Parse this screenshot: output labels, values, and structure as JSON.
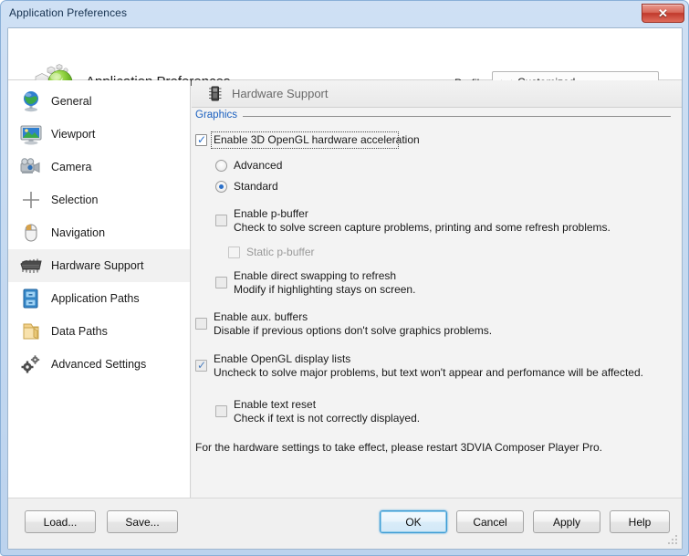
{
  "window": {
    "title": "Application Preferences",
    "close_label": "✕"
  },
  "header": {
    "app_title": "Application Preferences",
    "logo_icon": "3dvia-sphere-cubes-icon",
    "profile_label": "Profile",
    "profile_value": "Customized",
    "profile_icon": "profile-connector-icon"
  },
  "sidebar": {
    "items": [
      {
        "label": "General",
        "icon": "globe-icon",
        "selected": false
      },
      {
        "label": "Viewport",
        "icon": "monitor-icon",
        "selected": false
      },
      {
        "label": "Camera",
        "icon": "camera-icon",
        "selected": false
      },
      {
        "label": "Selection",
        "icon": "plus-cross-icon",
        "selected": false
      },
      {
        "label": "Navigation",
        "icon": "mouse-icon",
        "selected": false
      },
      {
        "label": "Hardware Support",
        "icon": "chip-icon",
        "selected": true
      },
      {
        "label": "Application Paths",
        "icon": "cabinet-icon",
        "selected": false
      },
      {
        "label": "Data Paths",
        "icon": "folder-icon",
        "selected": false
      },
      {
        "label": "Advanced Settings",
        "icon": "gears-icon",
        "selected": false
      }
    ]
  },
  "panel": {
    "header_title": "Hardware Support",
    "header_icon": "chip-icon",
    "group_label": "Graphics",
    "options": {
      "opengl_accel": {
        "label": "Enable 3D OpenGL hardware acceleration",
        "checked": true,
        "focused": true
      },
      "mode_advanced": {
        "label": "Advanced",
        "selected": false
      },
      "mode_standard": {
        "label": "Standard",
        "selected": true
      },
      "pbuffer": {
        "label": "Enable p-buffer",
        "description": "Check to solve screen capture problems, printing and some refresh problems.",
        "checked": false
      },
      "static_pbuffer": {
        "label": "Static p-buffer",
        "checked": false,
        "disabled": true
      },
      "direct_swapping": {
        "label": "Enable direct swapping to refresh",
        "description": "Modify if highlighting stays on screen.",
        "checked": false
      },
      "aux_buffers": {
        "label": "Enable aux. buffers",
        "description": "Disable if previous options don't solve graphics problems.",
        "checked": false
      },
      "display_lists": {
        "label": "Enable OpenGL display lists",
        "description": "Uncheck to solve major problems, but text won't appear and perfomance will be affected.",
        "checked": true
      },
      "text_reset": {
        "label": "Enable text reset",
        "description": "Check if text is not correctly displayed.",
        "checked": false
      }
    },
    "note": "For the hardware settings to take effect, please restart 3DVIA Composer Player Pro."
  },
  "footer": {
    "load_label": "Load...",
    "save_label": "Save...",
    "ok_label": "OK",
    "cancel_label": "Cancel",
    "apply_label": "Apply",
    "help_label": "Help"
  },
  "colors": {
    "accent_blue": "#1a5fbf",
    "check_blue": "#2a6fc9",
    "titlebar_blue": "#cfe0f4",
    "close_red": "#c0392b",
    "disabled_gray": "#9a9a9a"
  }
}
